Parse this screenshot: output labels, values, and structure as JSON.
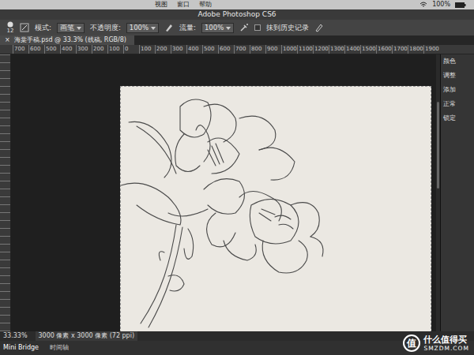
{
  "menubar": {
    "items": [
      "视图",
      "窗口",
      "帮助"
    ],
    "battery": "100%",
    "wifi_on": true
  },
  "window": {
    "title": "Adobe Photoshop CS6"
  },
  "options": {
    "brush_size": "12",
    "mode_label": "模式:",
    "mode": "画笔",
    "opacity_label": "不透明度:",
    "opacity": "100%",
    "flow_label": "流量:",
    "flow": "100%",
    "erase_history": {
      "label": "抹到历史记录",
      "checked": false
    }
  },
  "document_tab": {
    "title": "海棠手稿.psd @ 33.3% (线稿, RGB/8)",
    "close": "×",
    "selected": true
  },
  "ruler": {
    "ticks": [
      "700",
      "600",
      "500",
      "400",
      "300",
      "200",
      "100",
      "0",
      "100",
      "200",
      "300",
      "400",
      "500",
      "600",
      "700",
      "800",
      "900",
      "1000",
      "1100",
      "1200",
      "1300",
      "1400",
      "1500",
      "1600",
      "1700",
      "1800",
      "1900"
    ]
  },
  "right_panel": {
    "items": [
      "颜色",
      "调整",
      "添加",
      "正常",
      "锁定"
    ]
  },
  "status_bar": {
    "zoom": "33.33%",
    "size": "3000 像素 x 3000 像素 (72 ppi)"
  },
  "bottom_tabs": [
    {
      "label": "Mini Bridge",
      "selected": true
    },
    {
      "label": "时间轴",
      "selected": false
    }
  ],
  "watermark": {
    "glyph": "值",
    "name": "什么值得买",
    "site": "SMZDM.COM"
  }
}
